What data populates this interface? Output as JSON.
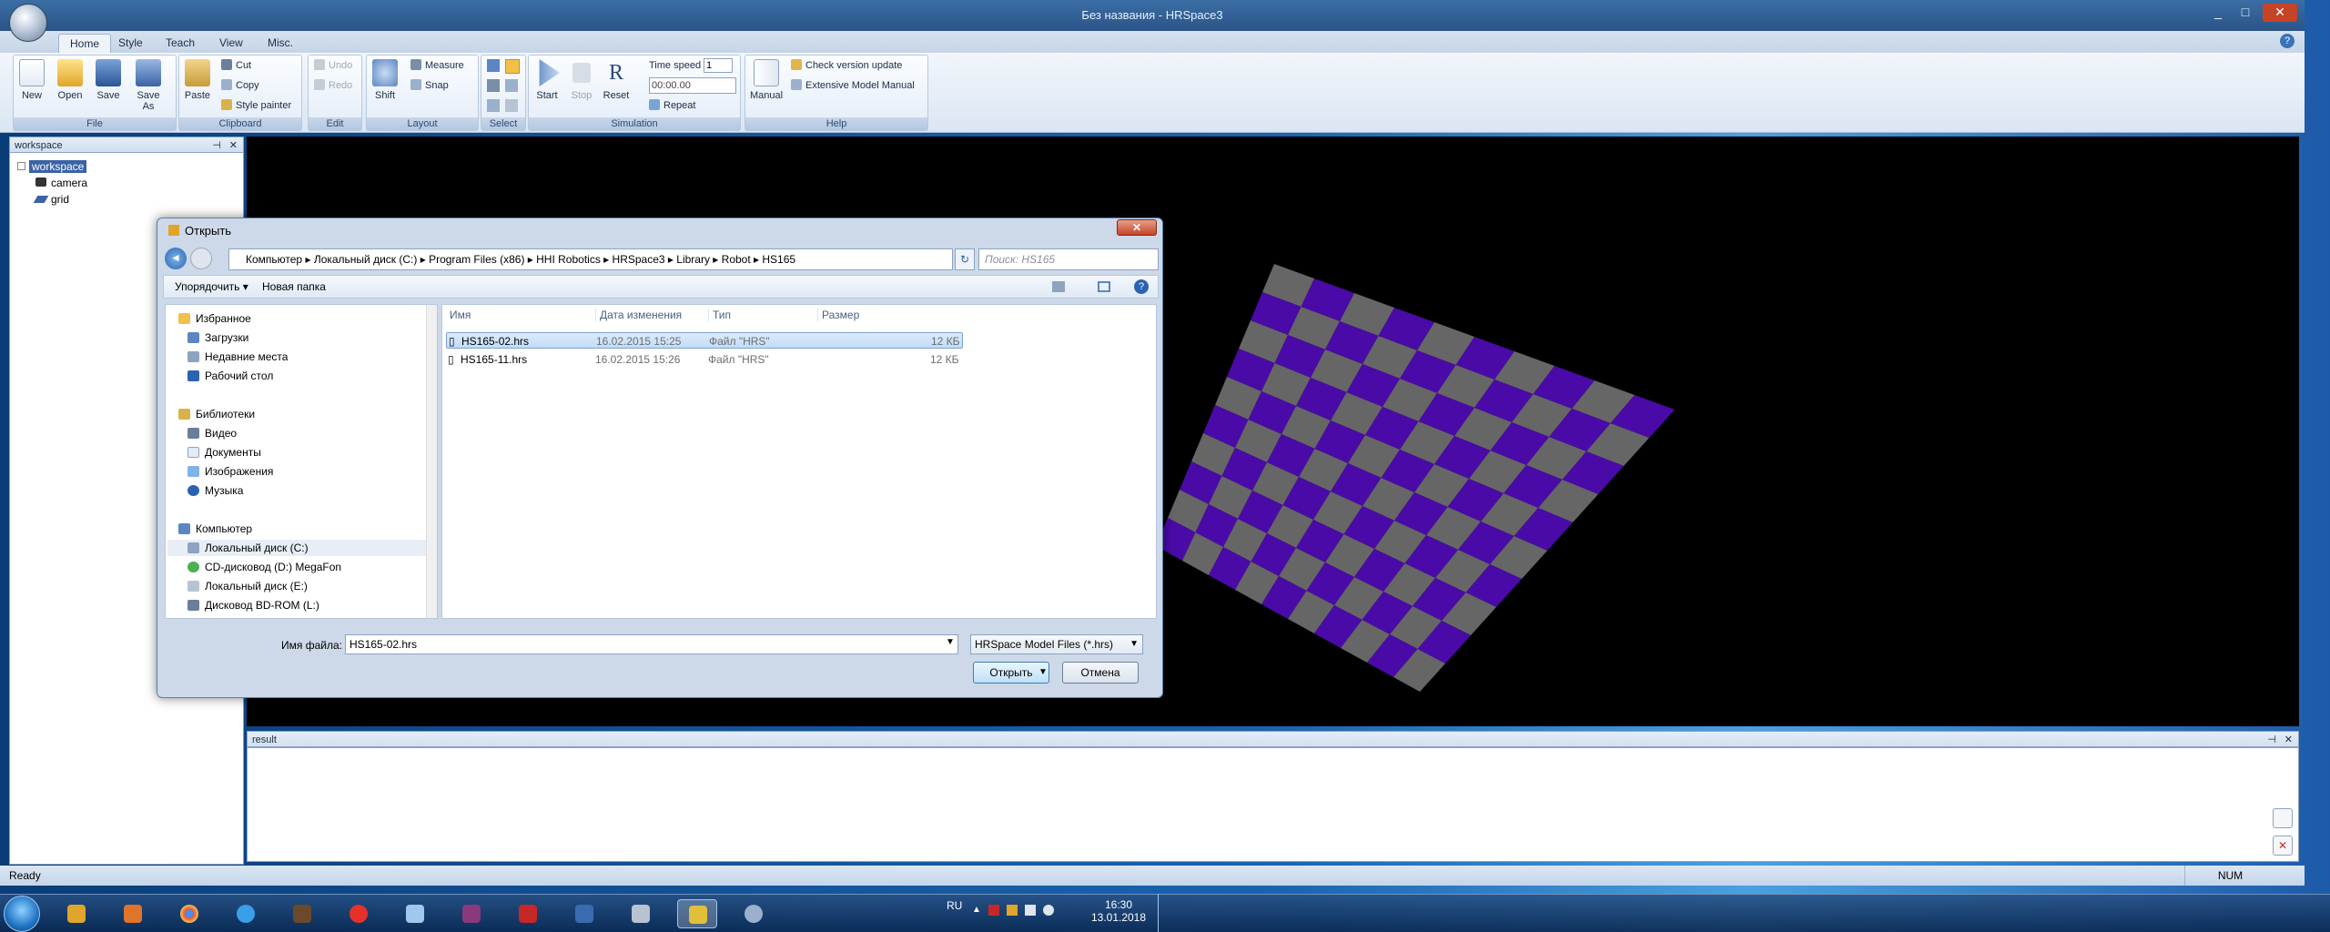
{
  "window": {
    "title": "Без названия - HRSpace3",
    "controls": [
      "_",
      "□",
      "✕"
    ]
  },
  "ribbon_tabs": [
    {
      "label": "Home"
    },
    {
      "label": "Style"
    },
    {
      "label": "Teach"
    },
    {
      "label": "View"
    },
    {
      "label": "Misc."
    }
  ],
  "ribbon": {
    "file": {
      "label": "File",
      "new": "New",
      "open": "Open",
      "save": "Save",
      "save_as": "Save As"
    },
    "clipboard": {
      "label": "Clipboard",
      "paste": "Paste",
      "cut": "Cut",
      "copy": "Copy",
      "style_painter": "Style painter"
    },
    "edit": {
      "label": "Edit",
      "undo": "Undo",
      "redo": "Redo"
    },
    "layout": {
      "label": "Layout",
      "shift": "Shift",
      "measure": "Measure",
      "snap": "Snap"
    },
    "select": {
      "label": "Select"
    },
    "simulation": {
      "label": "Simulation",
      "start": "Start",
      "stop": "Stop",
      "reset": "Reset",
      "time_speed_label": "Time speed",
      "time_speed_value": "1",
      "time_value": "00:00.00",
      "repeat": "Repeat"
    },
    "help": {
      "label": "Help",
      "manual": "Manual",
      "check_update": "Check version update",
      "extensive_manual": "Extensive Model Manual"
    }
  },
  "workspace_panel": {
    "title": "workspace",
    "tree": [
      "workspace",
      "camera",
      "grid"
    ]
  },
  "result_panel": {
    "title": "result"
  },
  "status": {
    "text": "Ready",
    "num": "NUM"
  },
  "dialog": {
    "title": "Открыть",
    "breadcrumb": [
      "Компьютер",
      "Локальный диск (C:)",
      "Program Files (x86)",
      "HHI Robotics",
      "HRSpace3",
      "Library",
      "Robot",
      "HS165"
    ],
    "search_placeholder": "Поиск: HS165",
    "organize": "Упорядочить",
    "new_folder": "Новая папка",
    "nav": {
      "favorites": "Избранное",
      "downloads": "Загрузки",
      "recent": "Недавние места",
      "desktop": "Рабочий стол",
      "libraries": "Библиотеки",
      "video": "Видео",
      "documents": "Документы",
      "pictures": "Изображения",
      "music": "Музыка",
      "computer": "Компьютер",
      "disk_c": "Локальный диск (C:)",
      "disk_d": "CD-дисковод (D:) MegaFon",
      "disk_e": "Локальный диск (E:)",
      "disk_l": "Дисковод BD-ROM (L:)"
    },
    "columns": {
      "name": "Имя",
      "date": "Дата изменения",
      "type": "Тип",
      "size": "Размер"
    },
    "files": [
      {
        "name": "HS165-02.hrs",
        "date": "16.02.2015 15:25",
        "type": "Файл \"HRS\"",
        "size": "12 КБ"
      },
      {
        "name": "HS165-11.hrs",
        "date": "16.02.2015 15:26",
        "type": "Файл \"HRS\"",
        "size": "12 КБ"
      }
    ],
    "filename_label": "Имя файла:",
    "filename_value": "HS165-02.hrs",
    "filetype": "HRSpace Model Files (*.hrs)",
    "open_btn": "Открыть",
    "cancel_btn": "Отмена"
  },
  "taskbar": {
    "lang": "RU",
    "time": "16:30",
    "date": "13.01.2018"
  },
  "colors": {
    "checker_a": "#4a0aa8",
    "checker_b": "#666666",
    "viewport": "#000000"
  }
}
